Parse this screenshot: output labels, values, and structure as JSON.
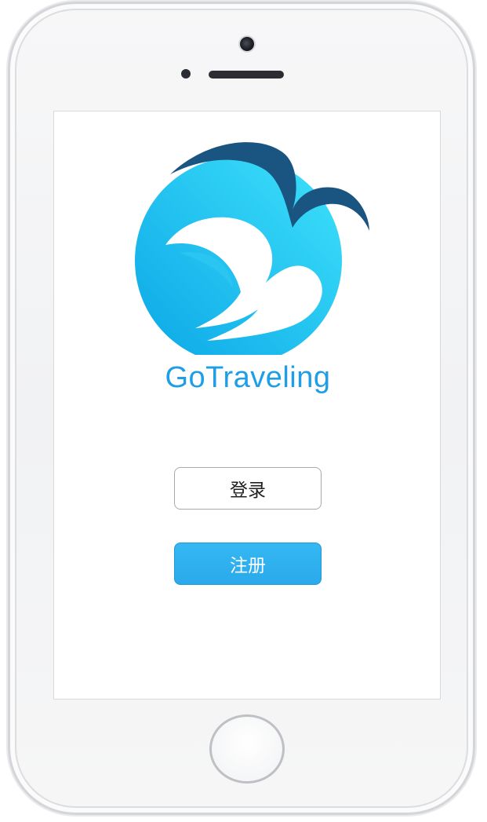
{
  "app": {
    "name": "GoTraveling"
  },
  "actions": {
    "login_label": "登录",
    "register_label": "注册"
  },
  "icons": {
    "logo": "wave-and-bird-logo",
    "camera": "front-camera-icon",
    "home": "home-button"
  },
  "colors": {
    "brand_blue": "#1d9ee6",
    "logo_dark_blue": "#1a5480",
    "register_button": "#2aa9ec"
  }
}
